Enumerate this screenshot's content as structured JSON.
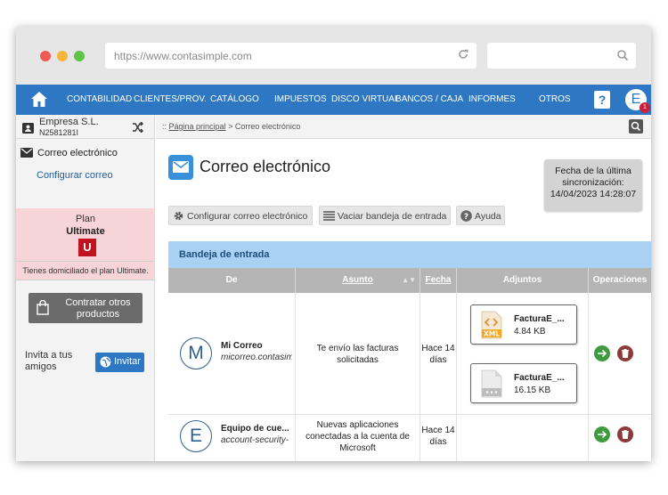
{
  "browser": {
    "url": "https://www.contasimple.com"
  },
  "nav": {
    "items": [
      "CONTABILIDAD",
      "CLIENTES/PROV.",
      "CATÁLOGO",
      "IMPUESTOS",
      "DISCO VIRTUAL",
      "BANCOS / CAJA",
      "INFORMES",
      "OTROS"
    ],
    "help_label": "?",
    "avatar_letter": "E",
    "notification_count": "1"
  },
  "sidebar": {
    "company_name": "Empresa S.L.",
    "company_id": "N2581281I",
    "mail_section": "Correo electrónico",
    "config_link": "Configurar correo",
    "plan_title": "Plan",
    "plan_name": "Ultimate",
    "plan_logo_letter": "U",
    "plan_note": "Tienes domiciliado el plan Ultimate.",
    "contract_label": "Contratar otros productos",
    "invite_text": "Invita a tus amigos",
    "invite_button": "Invitar"
  },
  "breadcrumb": {
    "home": "Página principal",
    "separator": " > ",
    "current": "Correo electrónico"
  },
  "main": {
    "title": "Correo electrónico",
    "sync_label": "Fecha de la última sincronización:",
    "sync_date": "14/04/2023 14:28:07",
    "toolbar": {
      "configure": "Configurar correo electrónico",
      "empty": "Vaciar bandeja de entrada",
      "help": "Ayuda"
    },
    "inbox_title": "Bandeja de entrada",
    "columns": {
      "from": "De",
      "subject": "Asunto",
      "date": "Fecha",
      "attachments": "Adjuntos",
      "operations": "Operaciones"
    },
    "rows": [
      {
        "avatar": "M",
        "sender": "Mi Correo",
        "email": "micorreo.contasimple",
        "subject": "Te envío las facturas solicitadas",
        "date": "Hace 14 días",
        "attachments": [
          {
            "type": "XML",
            "name": "FacturaE_...",
            "size": "4.84 KB"
          },
          {
            "type": "file",
            "name": "FacturaE_...",
            "size": "16.15 KB"
          }
        ]
      },
      {
        "avatar": "E",
        "sender": "Equipo de cue...",
        "email": "account-security-",
        "subject": "Nuevas aplicaciones conectadas a la cuenta de Microsoft",
        "date": "Hace 14 días",
        "attachments": []
      }
    ]
  },
  "colors": {
    "nav": "#2e77c3",
    "inbox_header": "#a9d1f4",
    "table_header": "#b5b5b5",
    "plan_bg": "#f6d4d7",
    "go_button": "#3f9a40",
    "delete_button": "#8e3a3a"
  },
  "icons": {
    "home": "home-icon",
    "shuffle": "shuffle-icon",
    "mail": "envelope-icon",
    "gear": "gear-icon",
    "list": "list-icon",
    "help": "help-circle-icon",
    "bag": "shopping-bag-icon",
    "globe": "globe-icon",
    "search": "search-icon",
    "reload": "reload-icon"
  }
}
